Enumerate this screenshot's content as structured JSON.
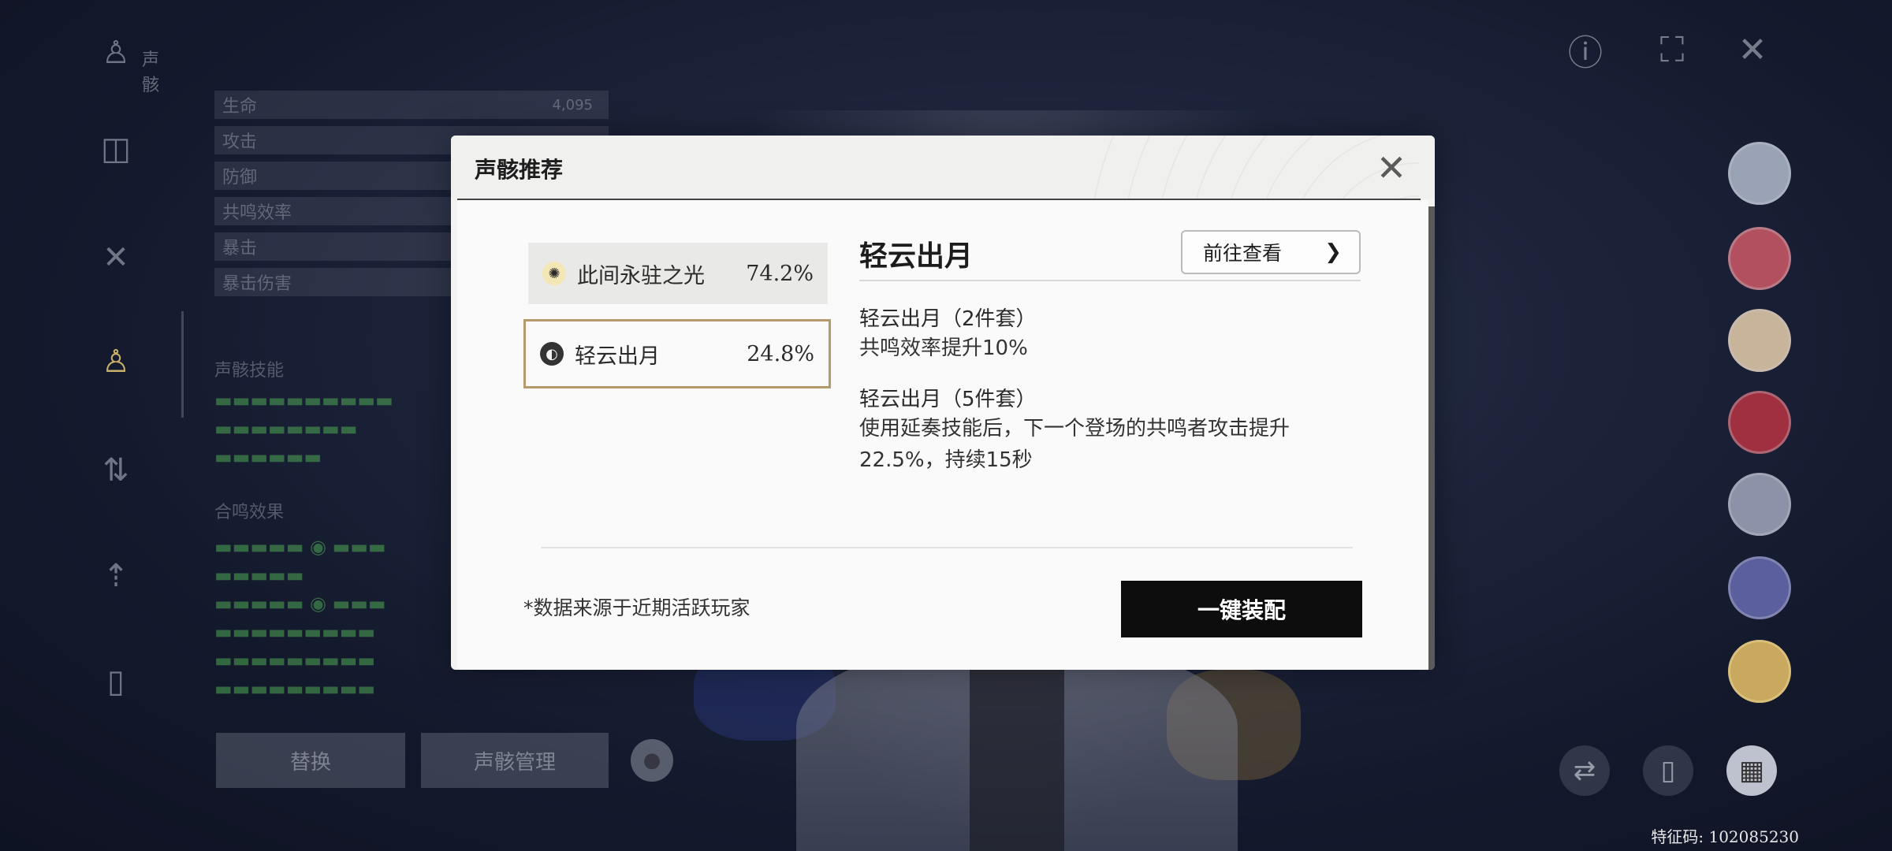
{
  "background": {
    "left_nav": {
      "title": "声骸",
      "icons": [
        "resonator-icon",
        "weapon-icon",
        "echo-icon",
        "skill-icon",
        "chain-icon",
        "profile-icon"
      ]
    },
    "stats": [
      {
        "label": "生命",
        "value": "4,095"
      },
      {
        "label": "攻击",
        "value": ""
      },
      {
        "label": "防御",
        "value": ""
      },
      {
        "label": "共鸣效率",
        "value": ""
      },
      {
        "label": "暴击",
        "value": ""
      },
      {
        "label": "暴击伤害",
        "value": ""
      }
    ],
    "echo_section_title": "声骸技能",
    "echo_set_title": "合鸣效果",
    "bottom_buttons": {
      "replace": "替换",
      "echo_manage": "声骸管理"
    },
    "uid_label": "特征码: 102085230"
  },
  "modal": {
    "title": "声骸推荐",
    "sets": [
      {
        "name": "此间永驻之光",
        "percent": "74.2%",
        "icon": "sun-icon",
        "selected": false
      },
      {
        "name": "轻云出月",
        "percent": "24.8%",
        "icon": "moon-icon",
        "selected": true
      }
    ],
    "detail": {
      "title": "轻云出月",
      "goto_label": "前往查看",
      "bonuses": [
        {
          "head": "轻云出月（2件套）",
          "text": "共鸣效率提升10%"
        },
        {
          "head": "轻云出月（5件套）",
          "text": "使用延奏技能后，下一个登场的共鸣者攻击提升22.5%，持续15秒"
        }
      ]
    },
    "source_note": "*数据来源于近期活跃玩家",
    "equip_label": "一键装配"
  },
  "colors": {
    "selected_border": "#b59a6e",
    "equip_button_bg": "#0d0d0d",
    "modal_bg": "#fafafa"
  }
}
